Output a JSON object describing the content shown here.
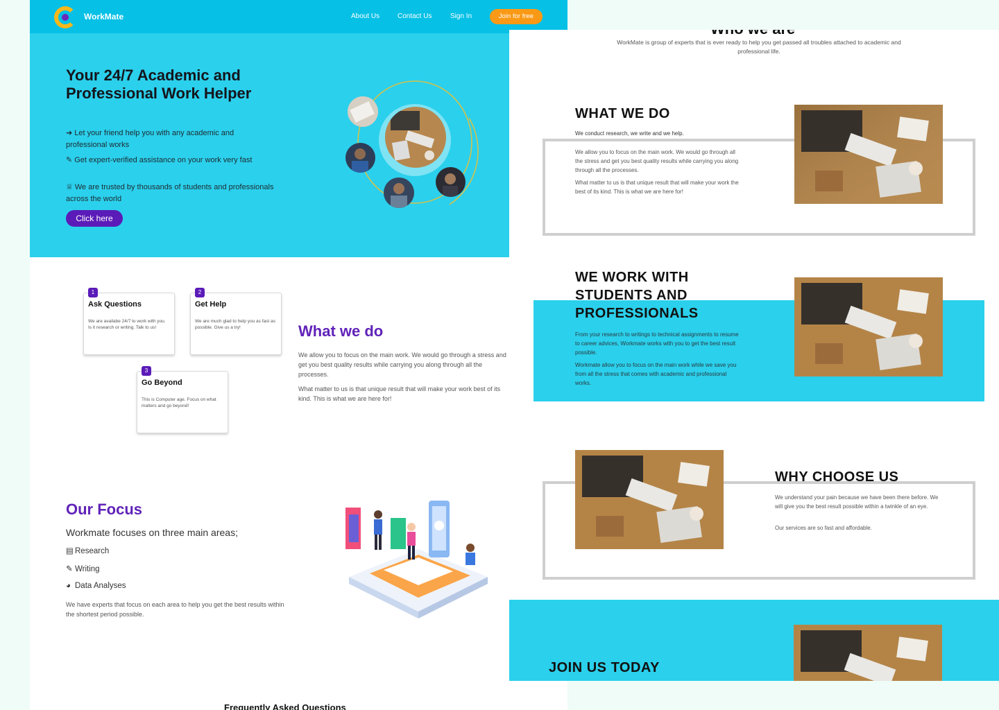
{
  "nav": {
    "brand": "WorkMate",
    "links": [
      "About Us",
      "Contact Us",
      "Sign In"
    ],
    "join": "Join for free"
  },
  "hero": {
    "title": "Your 24/7 Academic and Professional Work Helper",
    "points": [
      {
        "icon": "arrow-circle-icon",
        "text": "Let your friend help you with any academic and professional works"
      },
      {
        "icon": "pen-icon",
        "text": "Get expert-verified assistance on your work very fast"
      },
      {
        "icon": "ribbon-icon",
        "text": "We are trusted by thousands of students and professionals across the world"
      }
    ],
    "cta": "Click here"
  },
  "steps": [
    {
      "num": "1",
      "title": "Ask Questions",
      "text": "We are availabe 24/7 to work with you. Is it research or writing. Talk to us!"
    },
    {
      "num": "2",
      "title": "Get Help",
      "text": "We are much glad to help you as fast as possible. Give us a try!"
    },
    {
      "num": "3",
      "title": "Go Beyond",
      "text": "This is Computer age. Focus on what matters and go beyond!"
    }
  ],
  "what_we_do": {
    "title": "What we do",
    "para1": "We allow you to focus on the main work. We would go through a stress and get you best quality results while carrying you along through all the processes.",
    "para2": "What matter to us is that unique result that will make your work best of its kind. This is what we are here for!"
  },
  "focus": {
    "title": "Our Focus",
    "subtitle": "Workmate focuses on three main areas;",
    "items": [
      {
        "icon": "book-icon",
        "label": "Research"
      },
      {
        "icon": "pen-icon",
        "label": "Writing"
      },
      {
        "icon": "pie-chart-icon",
        "label": "Data Analyses"
      }
    ],
    "note": "We have experts that focus on each area to help you get the best results within the shortest period possible."
  },
  "faq_title": "Frequently Asked Questions",
  "right": {
    "who_title": "Who we are",
    "who_text": "WorkMate is group of experts that is ever ready to help you get passed all troubles attached to academic and professional life.",
    "wwd_title": "WHAT WE DO",
    "wwd_sub": "We conduct research, we write and we help.",
    "wwd_p1": "We allow you to focus on the main work. We would go through all the stress and get you best quality results while carrying you along through all the processes.",
    "wwd_p2": "What matter to us is that unique result that will make your work the best of its kind. This is what we are here for!",
    "students_title": "WE WORK WITH STUDENTS AND PROFESSIONALS",
    "students_p1": "From your research to writings to technical assignments to resume to career advices, Workmate works with you to get the best result possible.",
    "students_p2": "Workmate allow you to focus on the main work while we save you from all the stress that comes with academic and professional works.",
    "why_title": "WHY CHOOSE US",
    "why_p1": "We understand your pain because we have been there before. We will give you the best result possible within a twinkle of an eye.",
    "why_p2": "Our services are so fast and affordable.",
    "join_title": "JOIN US TODAY"
  },
  "colors": {
    "cyan": "#2bd0ec",
    "nav_cyan": "#06c0e6",
    "purple": "#5b1bb8",
    "orange": "#fa9915",
    "frame_gray": "#cfcfcf"
  }
}
